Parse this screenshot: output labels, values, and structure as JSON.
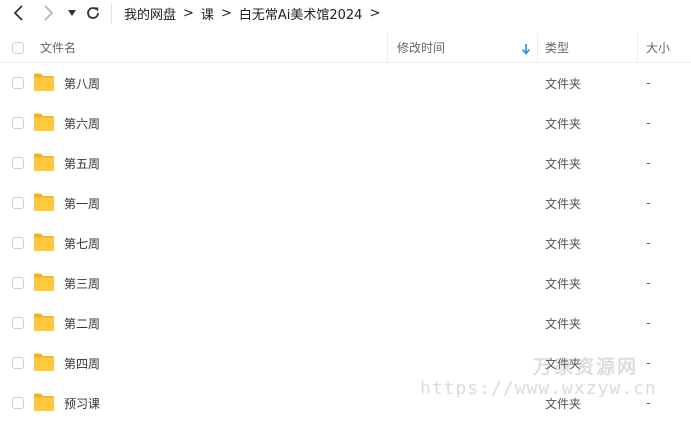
{
  "breadcrumb": [
    "我的网盘",
    "课",
    "白无常Ai美术馆2024"
  ],
  "breadcrumb_separator": ">",
  "columns": {
    "name": "文件名",
    "mtime": "修改时间",
    "type": "类型",
    "size": "大小"
  },
  "rows": [
    {
      "name": "第八周",
      "type": "文件夹",
      "size": "-"
    },
    {
      "name": "第六周",
      "type": "文件夹",
      "size": "-"
    },
    {
      "name": "第五周",
      "type": "文件夹",
      "size": "-"
    },
    {
      "name": "第一周",
      "type": "文件夹",
      "size": "-"
    },
    {
      "name": "第七周",
      "type": "文件夹",
      "size": "-"
    },
    {
      "name": "第三周",
      "type": "文件夹",
      "size": "-"
    },
    {
      "name": "第二周",
      "type": "文件夹",
      "size": "-"
    },
    {
      "name": "第四周",
      "type": "文件夹",
      "size": "-"
    },
    {
      "name": "预习课",
      "type": "文件夹",
      "size": "-"
    }
  ],
  "watermark": {
    "line1": "万家资源网",
    "line2": "https://www.wxzyw.cn"
  },
  "colors": {
    "folder": "#FFC83D",
    "folder_dark": "#F5B21C",
    "sort_icon": "#2B8CEB"
  },
  "icons": [
    "back-arrow-icon",
    "forward-arrow-icon",
    "dropdown-caret-icon",
    "refresh-icon",
    "sort-down-arrow-icon",
    "folder-icon"
  ]
}
